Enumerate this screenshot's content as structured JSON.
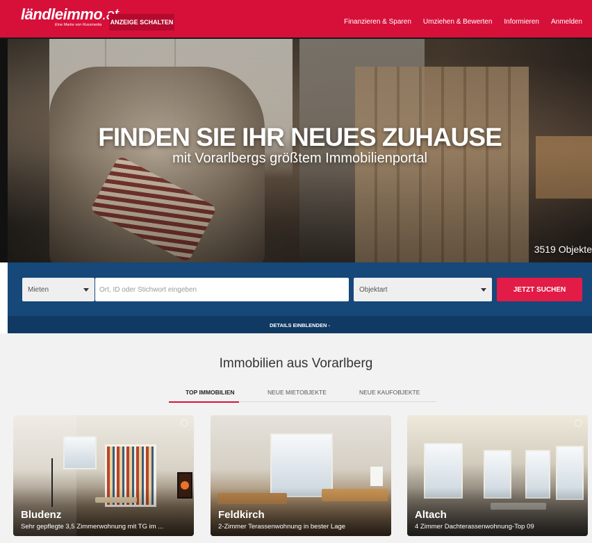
{
  "header": {
    "logo_bold_a": "ländle",
    "logo_bold_b": "immo",
    "logo_tld": ".at",
    "logo_tagline": "Eine Marke von Russmedia",
    "cta_label": "ANZEIGE SCHALTEN",
    "nav": [
      "Finanzieren & Sparen",
      "Umziehen & Bewerten",
      "Informieren",
      "Anmelden"
    ]
  },
  "hero": {
    "title": "FINDEN SIE IHR NEUES ZUHAUSE",
    "subtitle": "mit Vorarlbergs größtem Immobilienportal",
    "object_count": "3519 Objekte"
  },
  "search": {
    "mode_selected": "Mieten",
    "query_placeholder": "Ort, ID oder Stichwort eingeben",
    "type_selected": "Objektart",
    "button_label": "JETZT SUCHEN",
    "details_toggle": "DETAILS EINBLENDEN -"
  },
  "section": {
    "title": "Immobilien aus Vorarlberg",
    "tabs": [
      "TOP IMMOBILIEN",
      "NEUE MIETOBJEKTE",
      "NEUE KAUFOBJEKTE"
    ],
    "active_tab": 0
  },
  "listings": [
    {
      "city": "Bludenz",
      "description": "Sehr gepflegte 3,5 Zimmerwohnung mit TG im ..."
    },
    {
      "city": "Feldkirch",
      "description": "2-Zimmer Terassenwohnung in bester Lage"
    },
    {
      "city": "Altach",
      "description": "4 Zimmer Dachterassenwohnung-Top 09"
    }
  ],
  "colors": {
    "brand_red": "#d7103a",
    "search_blue": "#16487a",
    "search_button": "#e21b47"
  }
}
